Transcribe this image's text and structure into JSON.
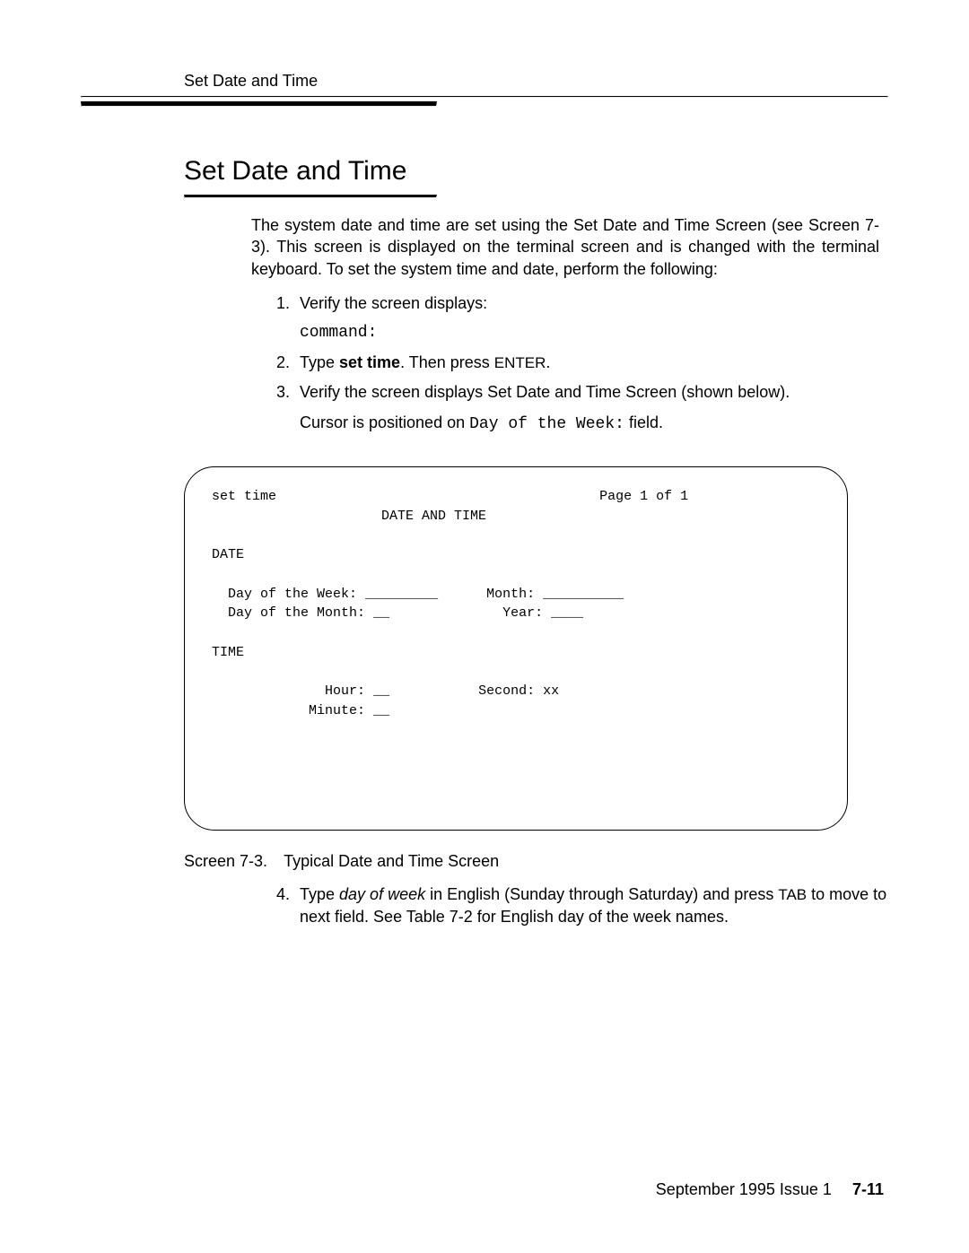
{
  "header": {
    "running_head": "Set Date and Time"
  },
  "section": {
    "title": "Set Date and Time",
    "intro": "The system date and time are set using the Set Date and Time Screen (see Screen 7-3). This screen is displayed on the terminal screen and is changed with the terminal keyboard. To set the system time and date, perform the following:"
  },
  "steps": {
    "s1": "Verify the screen displays:",
    "s1_code": "command:",
    "s2_a": "Type ",
    "s2_bold": "set time",
    "s2_b": ". Then press ",
    "s2_key": "ENTER",
    "s2_c": ".",
    "s3_a": "Verify the screen displays Set Date and Time Screen (shown below).",
    "s3_b1": "Cursor is positioned on ",
    "s3_code": "Day of the Week:",
    "s3_b2": " field.",
    "s4_a": "Type ",
    "s4_italic": "day of week",
    "s4_b": " in English (Sunday through Saturday) and press ",
    "s4_key": "TAB",
    "s4_c": " to move to next field.  See Table 7-2 for English day of the week names."
  },
  "screen": {
    "cmd": "set time",
    "page": "Page 1 of 1",
    "title": "DATE AND TIME",
    "date_hdr": "DATE",
    "dow_label": "Day of the Week:",
    "dow_blank": "_________",
    "month_label": "Month:",
    "month_blank": "__________",
    "dom_label": "Day of the Month:",
    "dom_blank": "__",
    "year_label": "Year:",
    "year_blank": "____",
    "time_hdr": "TIME",
    "hour_label": "Hour:",
    "hour_blank": "__",
    "second_label": "Second:",
    "second_val": "xx",
    "minute_label": "Minute:",
    "minute_blank": "__"
  },
  "caption": {
    "num": "Screen 7-3.",
    "text": "Typical Date and Time Screen"
  },
  "footer": {
    "issue": "September 1995 Issue 1",
    "page": "7-11"
  }
}
